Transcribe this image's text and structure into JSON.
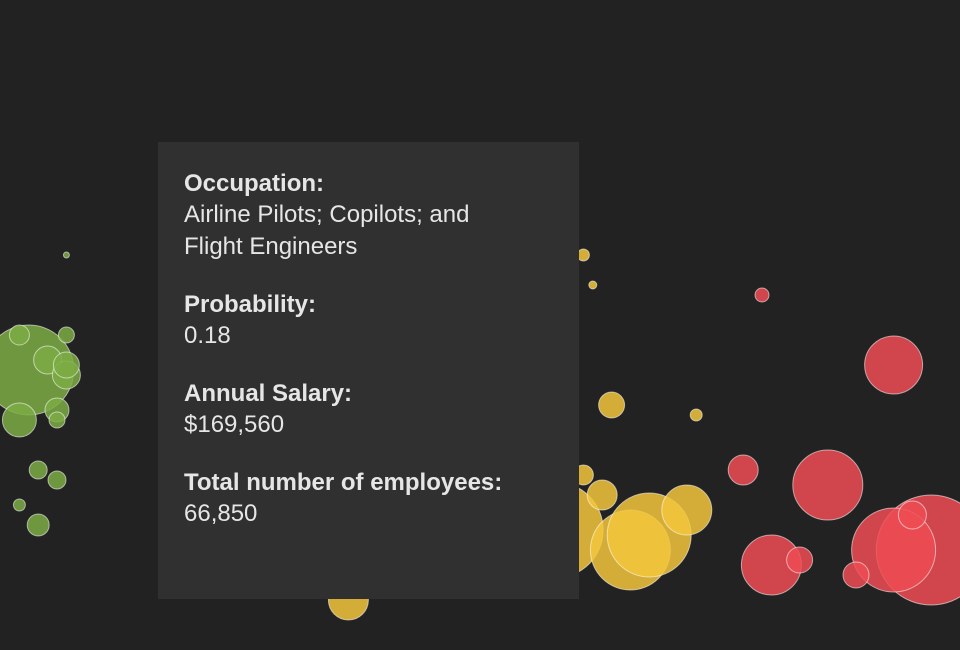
{
  "tooltip": {
    "occupation_label": "Occupation:",
    "occupation_value": "Airline Pilots; Copilots; and Flight Engineers",
    "probability_label": "Probability:",
    "probability_value": "0.18",
    "salary_label": "Annual Salary:",
    "salary_value": "$169,560",
    "employees_label": "Total number of employees:",
    "employees_value": "66,850"
  },
  "chart_data": {
    "type": "scatter",
    "title": "",
    "xlabel": "",
    "ylabel": "",
    "colors": {
      "low": "#7cac44",
      "mid": "#f3c53c",
      "high": "#ee4c54"
    },
    "legend": "none",
    "series": [
      {
        "color_group": "low",
        "points": [
          {
            "x": 0.02,
            "y": 0.54,
            "r": 45
          },
          {
            "x": 0.01,
            "y": 0.61,
            "r": 10
          },
          {
            "x": 0.04,
            "y": 0.56,
            "r": 14
          },
          {
            "x": 0.01,
            "y": 0.44,
            "r": 17
          },
          {
            "x": 0.06,
            "y": 0.53,
            "r": 14
          },
          {
            "x": 0.06,
            "y": 0.55,
            "r": 13
          },
          {
            "x": 0.05,
            "y": 0.46,
            "r": 12
          },
          {
            "x": 0.03,
            "y": 0.34,
            "r": 9
          },
          {
            "x": 0.05,
            "y": 0.32,
            "r": 9
          },
          {
            "x": 0.05,
            "y": 0.44,
            "r": 8
          },
          {
            "x": 0.03,
            "y": 0.23,
            "r": 11
          },
          {
            "x": 0.01,
            "y": 0.27,
            "r": 6
          },
          {
            "x": 0.06,
            "y": 0.61,
            "r": 8
          },
          {
            "x": 0.06,
            "y": 0.77,
            "r": 3
          }
        ]
      },
      {
        "color_group": "mid",
        "points": [
          {
            "x": 0.64,
            "y": 0.47,
            "r": 13
          },
          {
            "x": 0.58,
            "y": 0.22,
            "r": 48
          },
          {
            "x": 0.66,
            "y": 0.18,
            "r": 40
          },
          {
            "x": 0.68,
            "y": 0.21,
            "r": 42
          },
          {
            "x": 0.72,
            "y": 0.26,
            "r": 25
          },
          {
            "x": 0.63,
            "y": 0.29,
            "r": 15
          },
          {
            "x": 0.61,
            "y": 0.33,
            "r": 10
          },
          {
            "x": 0.61,
            "y": 0.77,
            "r": 6
          },
          {
            "x": 0.62,
            "y": 0.71,
            "r": 4
          },
          {
            "x": 0.73,
            "y": 0.45,
            "r": 6
          },
          {
            "x": 0.36,
            "y": 0.08,
            "r": 20
          }
        ]
      },
      {
        "color_group": "high",
        "points": [
          {
            "x": 0.94,
            "y": 0.55,
            "r": 29
          },
          {
            "x": 0.87,
            "y": 0.31,
            "r": 35
          },
          {
            "x": 0.98,
            "y": 0.18,
            "r": 55
          },
          {
            "x": 0.94,
            "y": 0.18,
            "r": 42
          },
          {
            "x": 0.81,
            "y": 0.15,
            "r": 30
          },
          {
            "x": 0.78,
            "y": 0.34,
            "r": 15
          },
          {
            "x": 0.84,
            "y": 0.16,
            "r": 13
          },
          {
            "x": 0.9,
            "y": 0.13,
            "r": 13
          },
          {
            "x": 0.8,
            "y": 0.69,
            "r": 7
          },
          {
            "x": 0.96,
            "y": 0.25,
            "r": 14
          }
        ]
      }
    ],
    "xlim": [
      0,
      1
    ],
    "ylim": [
      0,
      1
    ],
    "grid": false
  }
}
